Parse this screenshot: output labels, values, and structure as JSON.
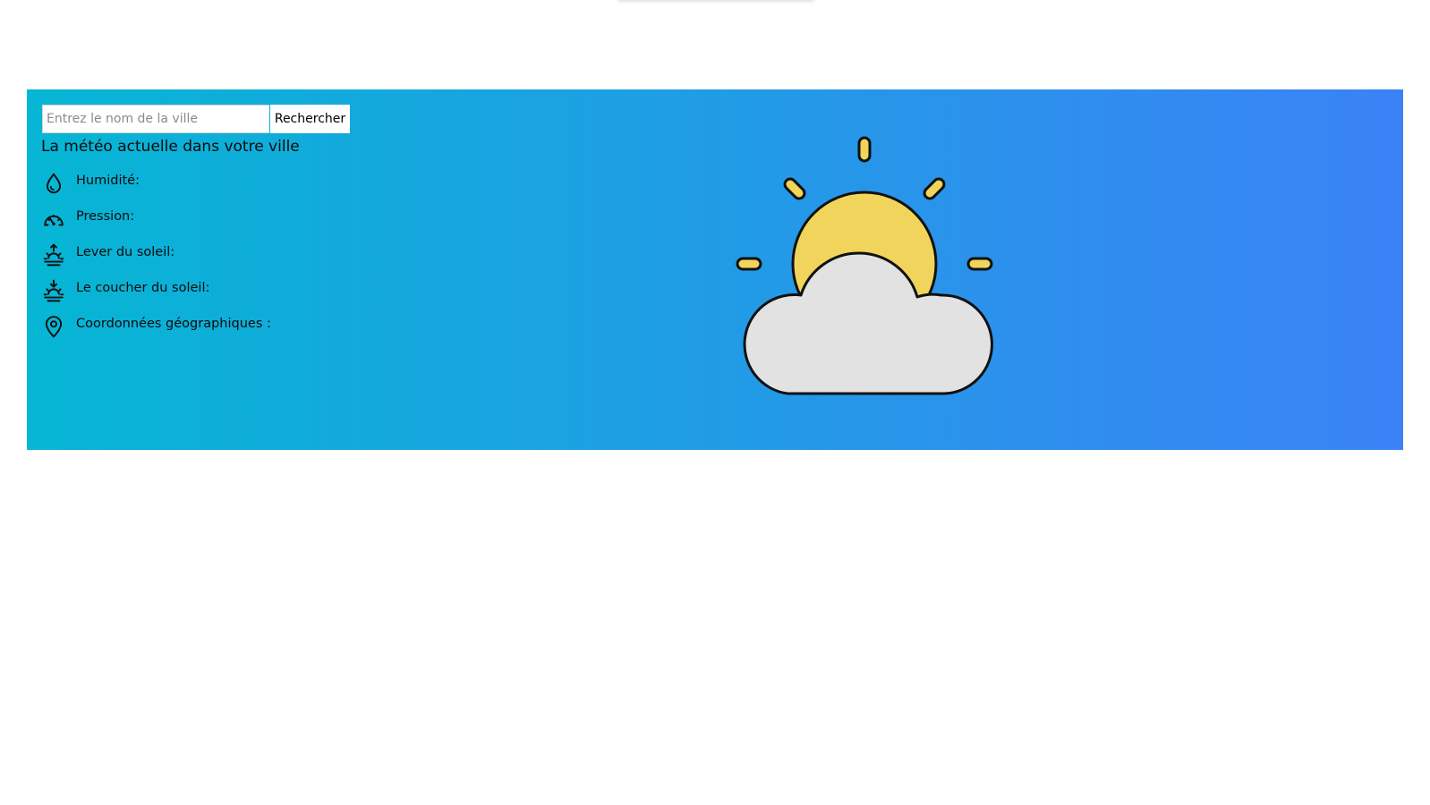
{
  "search": {
    "placeholder": "Entrez le nom de la ville",
    "value": "",
    "button_label": "Rechercher"
  },
  "headline": "La météo actuelle dans votre ville",
  "details": {
    "humidity": {
      "label": "Humidité:",
      "icon": "droplet-icon"
    },
    "pressure": {
      "label": "Pression:",
      "icon": "gauge-icon"
    },
    "sunrise": {
      "label": "Lever du soleil:",
      "icon": "sunrise-icon"
    },
    "sunset": {
      "label": "Le coucher du soleil:",
      "icon": "sunset-icon"
    },
    "coordinates": {
      "label": "Coordonnées géographiques :",
      "icon": "map-pin-icon"
    }
  },
  "weather_icon": "partly-cloudy-icon",
  "colors": {
    "gradient_start": "#06b6d4",
    "gradient_end": "#3b82f6",
    "sun": "#f0d45c",
    "cloud": "#e2e2e2"
  }
}
